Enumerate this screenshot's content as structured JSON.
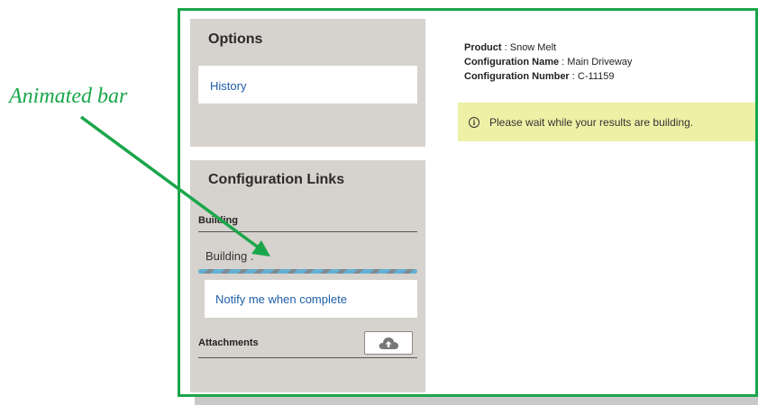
{
  "options_panel": {
    "title": "Options",
    "history_link": "History"
  },
  "config_links_panel": {
    "title": "Configuration Links",
    "building_header": "Building",
    "building_status": "Building .",
    "progress_indeterminate": true,
    "notify_link": "Notify me when complete",
    "attachments_header": "Attachments",
    "upload_icon": "cloud-upload-icon"
  },
  "details": {
    "product_label": "Product",
    "product_value": "Snow Melt",
    "config_name_label": "Configuration Name",
    "config_name_value": "Main Driveway",
    "config_number_label": "Configuration Number",
    "config_number_value": "C-11159",
    "separator": " : "
  },
  "banner": {
    "icon": "info-icon",
    "message": "Please wait while your results are building."
  },
  "annotation": {
    "label": "Animated bar",
    "color": "#1aa64a"
  }
}
